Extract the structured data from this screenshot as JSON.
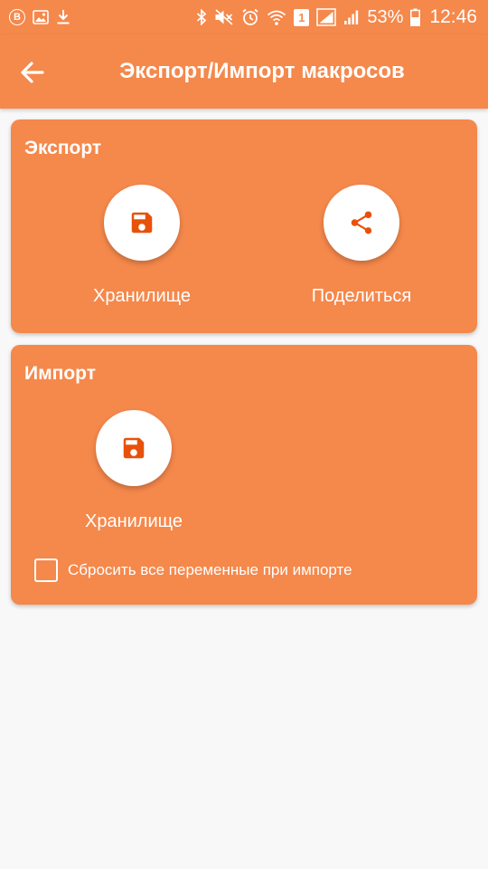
{
  "colors": {
    "accent": "#f5884b",
    "icon": "#e8510a",
    "background": "#f8f8f8"
  },
  "status_bar": {
    "left_badge": "B",
    "sim_number": "1",
    "battery_percent": "53%",
    "time": "12:46",
    "icons": [
      "b-circle-icon",
      "image-icon",
      "download-icon",
      "bluetooth-icon",
      "mute-icon",
      "alarm-icon",
      "wifi-icon",
      "sim1-icon",
      "signal-icon",
      "signal-icon",
      "battery-icon"
    ]
  },
  "app_bar": {
    "back_icon": "arrow-left-icon",
    "title": "Экспорт/Импорт макросов"
  },
  "export_card": {
    "title": "Экспорт",
    "actions": [
      {
        "icon": "floppy-disk-icon",
        "label": "Хранилище"
      },
      {
        "icon": "share-icon",
        "label": "Поделиться"
      }
    ]
  },
  "import_card": {
    "title": "Импорт",
    "actions": [
      {
        "icon": "floppy-disk-icon",
        "label": "Хранилище"
      }
    ],
    "checkbox": {
      "label": "Сбросить все переменные при импорте",
      "checked": false
    }
  }
}
